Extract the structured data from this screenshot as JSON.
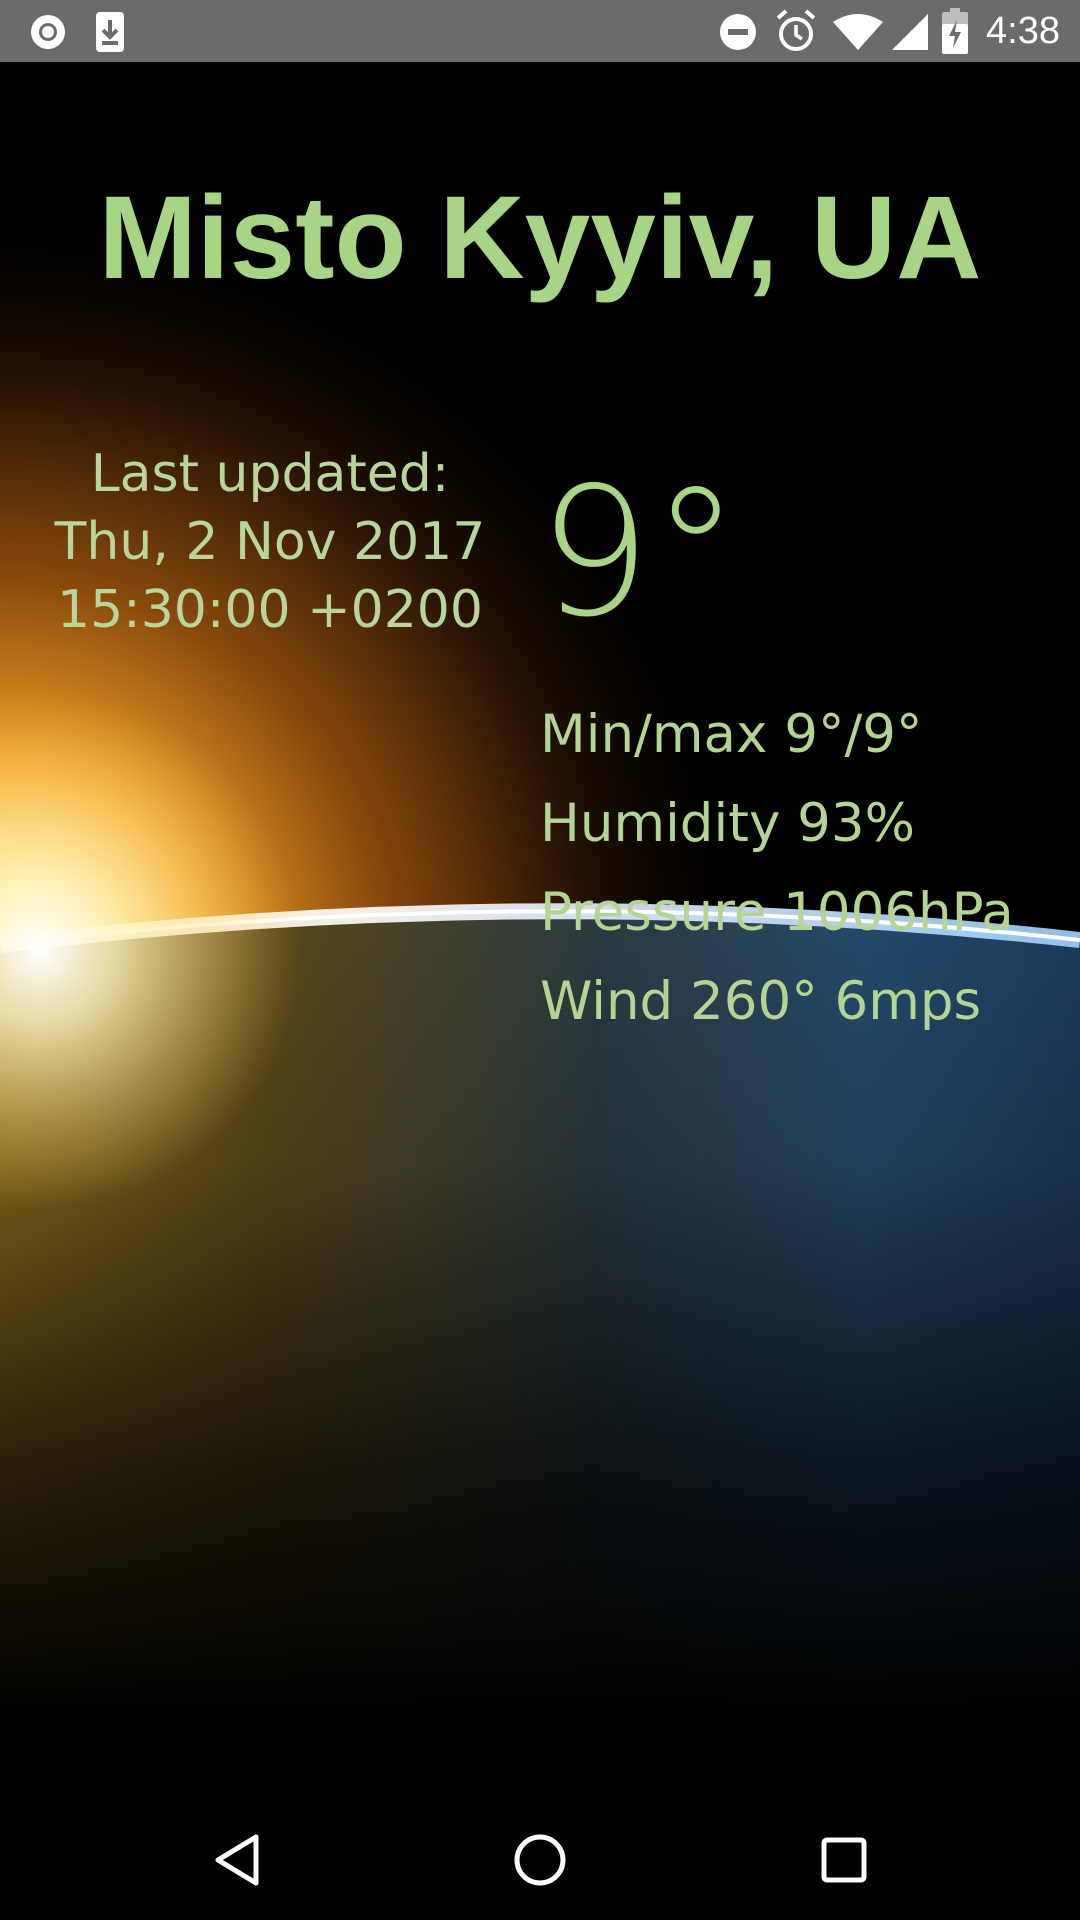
{
  "status_bar": {
    "time": "4:38",
    "left_icons": [
      "record-icon",
      "download-icon"
    ],
    "right_icons": [
      "do-not-disturb-icon",
      "alarm-icon",
      "wifi-icon",
      "cell-signal-icon",
      "battery-charging-icon"
    ]
  },
  "weather": {
    "city": "Misto Kyyiv, UA",
    "last_updated_label": "Last updated:",
    "last_updated_date": "Thu, 2 Nov 2017",
    "last_updated_time": "15:30:00 +0200",
    "temperature": "9°",
    "min_max": "Min/max 9°/9°",
    "humidity": "Humidity 93%",
    "pressure": "Pressure 1006hPa",
    "wind": "Wind 260° 6mps"
  },
  "nav_bar": {
    "icons": [
      "back-icon",
      "home-icon",
      "recents-icon"
    ]
  },
  "colors": {
    "accent_text": "#a7d585",
    "status_bar_bg": "#6b6b6b",
    "background": "#000000"
  }
}
